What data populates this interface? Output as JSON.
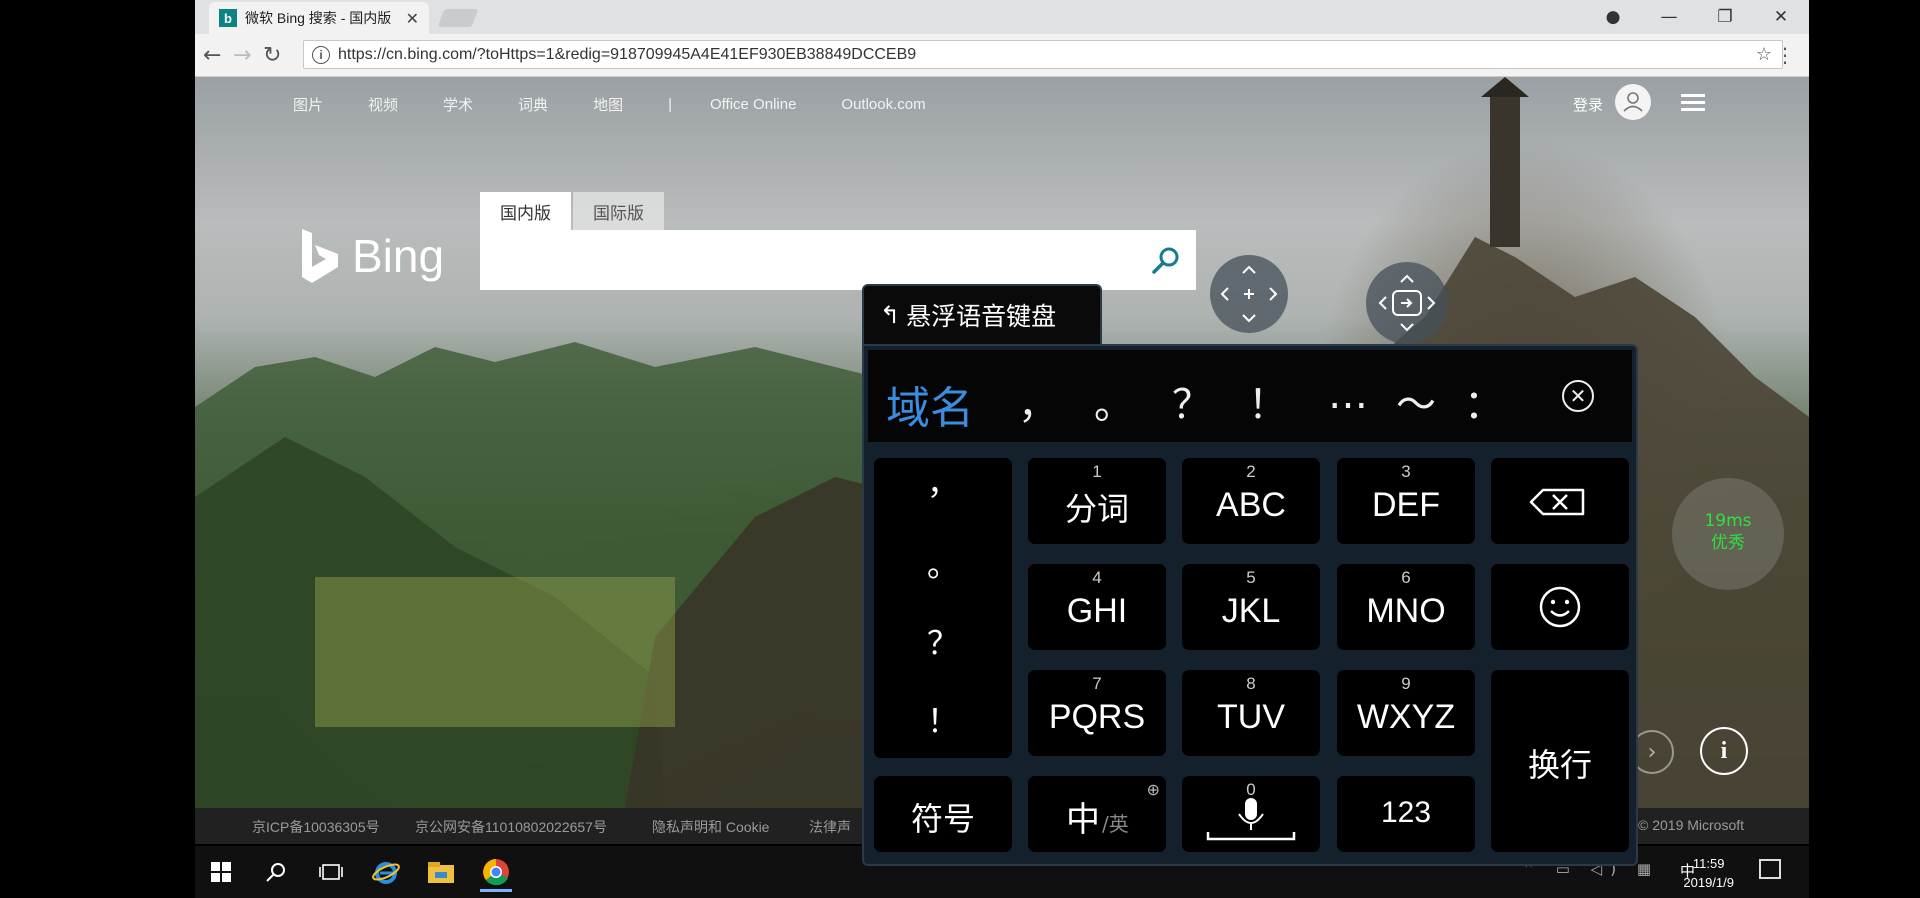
{
  "browser": {
    "tab_title": "微软 Bing 搜索 - 国内版",
    "tab_favicon": "b",
    "url": "https://cn.bing.com/?toHttps=1&redig=918709945A4E41EF930EB38849DCCEB9"
  },
  "page": {
    "nav_items": [
      "图片",
      "视频",
      "学术",
      "词典",
      "地图"
    ],
    "nav_separator": "|",
    "nav_links": [
      "Office Online",
      "Outlook.com"
    ],
    "login_label": "登录",
    "logo_text": "Bing",
    "search_tabs": [
      "国内版",
      "国际版"
    ],
    "search_value": "",
    "footer_items": [
      "京ICP备10036305号",
      "京公网安备11010802022657号",
      "隐私声明和 Cookie",
      "法律声"
    ],
    "copyright": "© 2019 Microsoft"
  },
  "taskbar": {
    "time": "11:59",
    "date": "2019/1/9",
    "ime_indicator": "中"
  },
  "keyboard": {
    "title": "悬浮语音键盘",
    "candidate_primary": "域名",
    "candidates": [
      "，",
      "。",
      "？",
      "！",
      "…",
      "～",
      "："
    ],
    "punct_column": [
      "，",
      "。",
      "？",
      "！"
    ],
    "keys": [
      {
        "num": "1",
        "label": "分词"
      },
      {
        "num": "2",
        "label": "ABC"
      },
      {
        "num": "3",
        "label": "DEF"
      },
      {
        "num": "4",
        "label": "GHI"
      },
      {
        "num": "5",
        "label": "JKL"
      },
      {
        "num": "6",
        "label": "MNO"
      },
      {
        "num": "7",
        "label": "PQRS"
      },
      {
        "num": "8",
        "label": "TUV"
      },
      {
        "num": "9",
        "label": "WXYZ"
      }
    ],
    "enter_label": "换行",
    "symbols_label": "符号",
    "lang_main": "中",
    "lang_alt": "/英",
    "space_num": "0",
    "numeric_label": "123",
    "latency_value": "19ms",
    "latency_rating": "优秀"
  },
  "colors": {
    "candidate_highlight": "#3b8de0",
    "latency_text": "#30e040",
    "keyboard_bg": "#14202c",
    "key_bg": "#000000"
  }
}
